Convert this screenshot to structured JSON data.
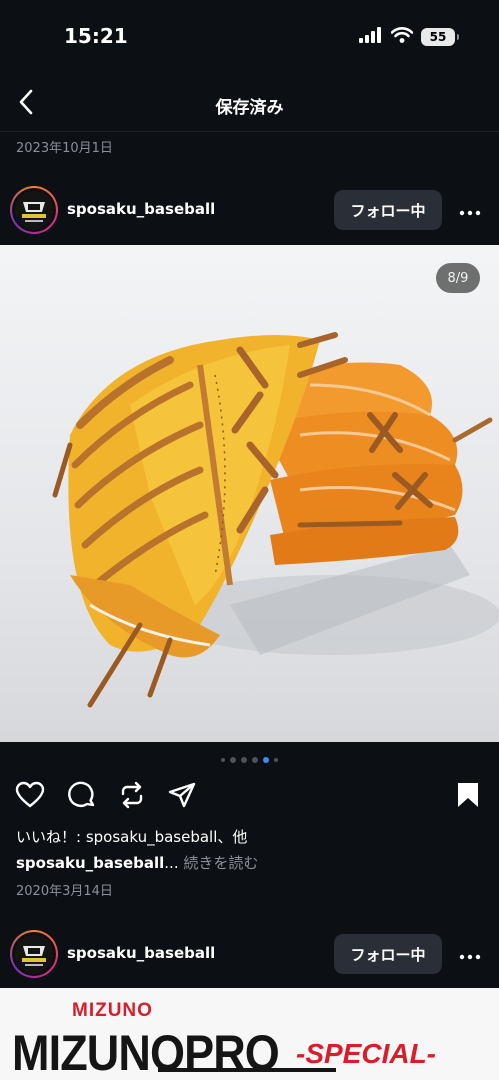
{
  "status_bar": {
    "time": "15:21",
    "battery": "55"
  },
  "nav": {
    "title": "保存済み"
  },
  "saved_date": "2023年10月1日",
  "posts": [
    {
      "username": "sposaku_baseball",
      "follow_label": "フォロー中",
      "image_counter": "8/9",
      "likes_text": "いいね！: sposaku_baseball、他",
      "caption_user": "sposaku_baseball",
      "caption_ellipsis": "...",
      "caption_more": "続きを読む",
      "date": "2020年3月14日"
    },
    {
      "username": "sposaku_baseball",
      "follow_label": "フォロー中",
      "image_text": {
        "brand_small": "MIZUNO",
        "brand_big": "MIZUNOPRO",
        "special": "-SPECIAL-"
      }
    }
  ],
  "carousel": {
    "total": 6,
    "active": 4
  },
  "icons": [
    "chevron-left-icon",
    "more-icon",
    "heart-icon",
    "comment-icon",
    "repost-icon",
    "share-icon",
    "bookmark-icon"
  ],
  "colors": {
    "background": "#0c0f14",
    "follow_button": "#2a2e36",
    "active_dot": "#3a8ff0",
    "brand_red": "#d81e2a"
  }
}
